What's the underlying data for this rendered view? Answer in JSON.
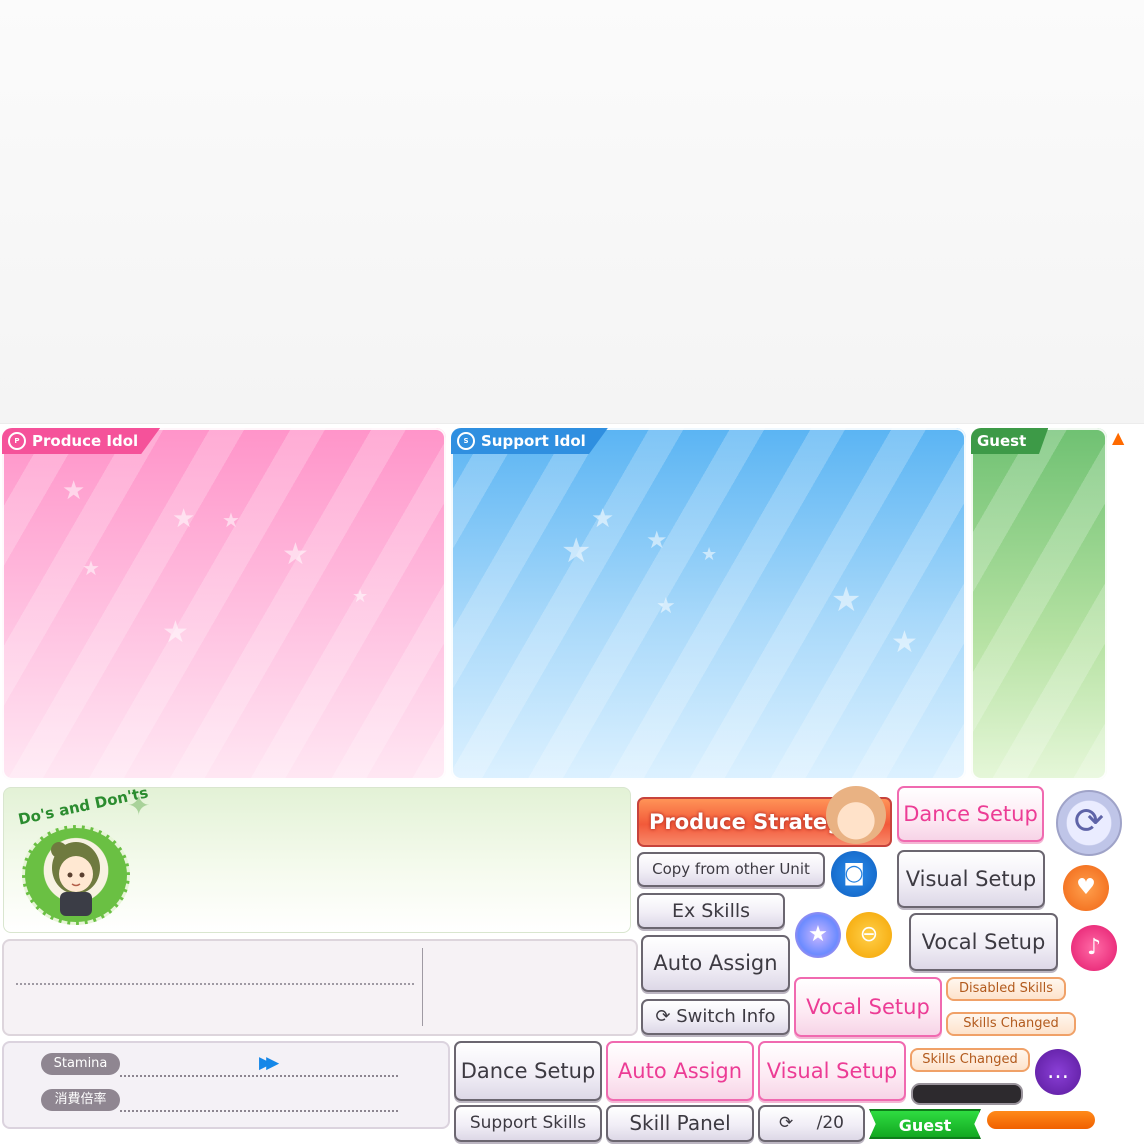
{
  "panels": {
    "produce_label": "Produce Idol",
    "produce_icon": "P",
    "support_label": "Support Idol",
    "support_icon": "S",
    "guest_label": "Guest"
  },
  "dos": {
    "title": "Do's and Don'ts"
  },
  "stamina": {
    "stamina_label": "Stamina",
    "rate_label": "消費倍率"
  },
  "buttons": {
    "produce_strategy": "Produce Strategy",
    "dance_setup": "Dance Setup",
    "copy_from_other_unit": "Copy from other Unit",
    "visual_setup": "Visual Setup",
    "ex_skills": "Ex Skills",
    "vocal_setup": "Vocal Setup",
    "auto_assign": "Auto Assign",
    "switch_info": "Switch Info",
    "vocal_setup_pink": "Vocal Setup",
    "dance_setup_bottom": "Dance Setup",
    "auto_assign_pink": "Auto Assign",
    "visual_setup_pink": "Visual Setup",
    "support_skills": "Support Skills",
    "skill_panel": "Skill Panel",
    "counter": "/20",
    "guest": "Guest"
  },
  "tags": {
    "disabled_skills": "Disabled Skills",
    "skills_changed_1": "Skills Changed",
    "skills_changed_2": "Skills Changed"
  },
  "icons": {
    "refresh": "refresh-icon",
    "speaker": "speaker-icon",
    "heart": "heart-icon",
    "star": "star-icon",
    "mirror": "hand-mirror-icon",
    "microphone": "microphone-icon",
    "chat": "chat-bubble-icon",
    "up_arrow": "up-arrow-icon",
    "fast_forward": "fast-forward-icon"
  },
  "colors": {
    "produce": "#ff94c9",
    "support": "#5ab4f3",
    "guest": "#6fc172",
    "strategy": "#f25a3a",
    "pink_accent": "#ec3c95"
  }
}
